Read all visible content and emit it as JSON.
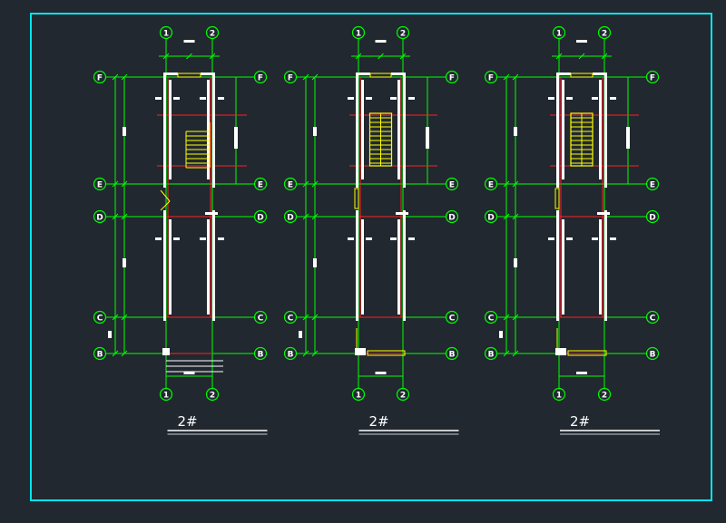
{
  "colors": {
    "background": "#212830",
    "frame": "#00e5ee",
    "axis": "#00ff00",
    "wall": "#ffffff",
    "beam": "#ff2020",
    "stair": "#ffff00",
    "title": "#ffffff"
  },
  "axes": {
    "rows": [
      "F",
      "E",
      "D",
      "C",
      "B"
    ],
    "columns": [
      "1",
      "2"
    ]
  },
  "plans": [
    {
      "id": "plan-1",
      "title": "2#"
    },
    {
      "id": "plan-2",
      "title": "2#"
    },
    {
      "id": "plan-3",
      "title": "2#"
    }
  ]
}
